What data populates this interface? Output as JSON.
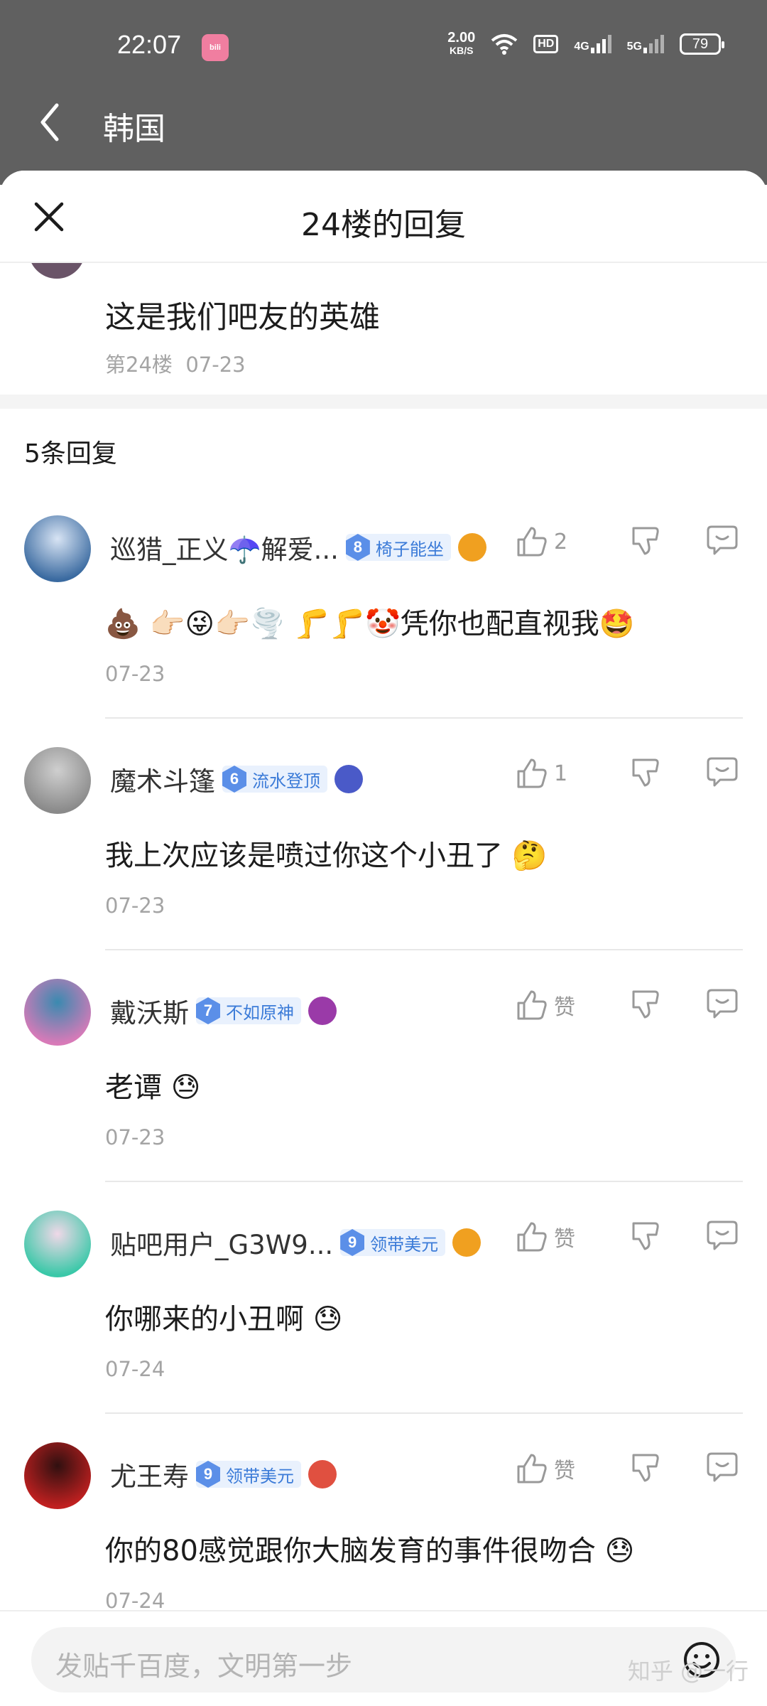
{
  "status_bar": {
    "time": "22:07",
    "app_badge": "bili",
    "net_speed": "2.00",
    "net_unit": "KB/S",
    "hd": "HD",
    "sig1": "4G",
    "sig2": "5G",
    "battery": "79"
  },
  "nav": {
    "title": "韩国"
  },
  "sheet": {
    "title": "24楼的回复",
    "op_text": "这是我们吧友的英雄",
    "op_floor": "第24楼",
    "op_date": "07-23",
    "count": "5条回复"
  },
  "replies": [
    {
      "name": "巡猎_正义☂️解爱...",
      "level": "8",
      "badge": "椅子能坐",
      "medal_color": "#f0a020",
      "likes": "2",
      "text": "💩 👉🏻😜👉🏻🌪️ 🦵🦵🤡凭你也配直视我🤩",
      "date": "07-23",
      "avatar_colors": [
        "#3a6aa0",
        "#d8e4f4"
      ]
    },
    {
      "name": "魔术斗篷",
      "level": "6",
      "badge": "流水登顶",
      "medal_color": "#4a5ac8",
      "likes": "1",
      "text": "我上次应该是喷过你这个小丑了 🤔",
      "date": "07-23",
      "avatar_colors": [
        "#8a8a8a",
        "#cfcfcf"
      ]
    },
    {
      "name": "戴沃斯",
      "level": "7",
      "badge": "不如原神",
      "medal_color": "#9a3aa8",
      "likes": "赞",
      "text": "老谭 😓",
      "date": "07-23",
      "avatar_colors": [
        "#d87ab8",
        "#3a8ab0"
      ]
    },
    {
      "name": "贴吧用户_G3W9...",
      "level": "9",
      "badge": "领带美元",
      "medal_color": "#f0a020",
      "likes": "赞",
      "text": "你哪来的小丑啊 😓",
      "date": "07-24",
      "avatar_colors": [
        "#3ac8a8",
        "#f0d8e8"
      ]
    },
    {
      "name": "尤王寿",
      "level": "9",
      "badge": "领带美元",
      "medal_color": "#e05040",
      "likes": "赞",
      "text": "你的80感觉跟你大脑发育的事件很吻合 😓",
      "date": "07-24",
      "avatar_colors": [
        "#c02020",
        "#301010"
      ]
    }
  ],
  "input": {
    "placeholder": "发贴千百度，文明第一步"
  },
  "watermark": "知乎 @一行"
}
